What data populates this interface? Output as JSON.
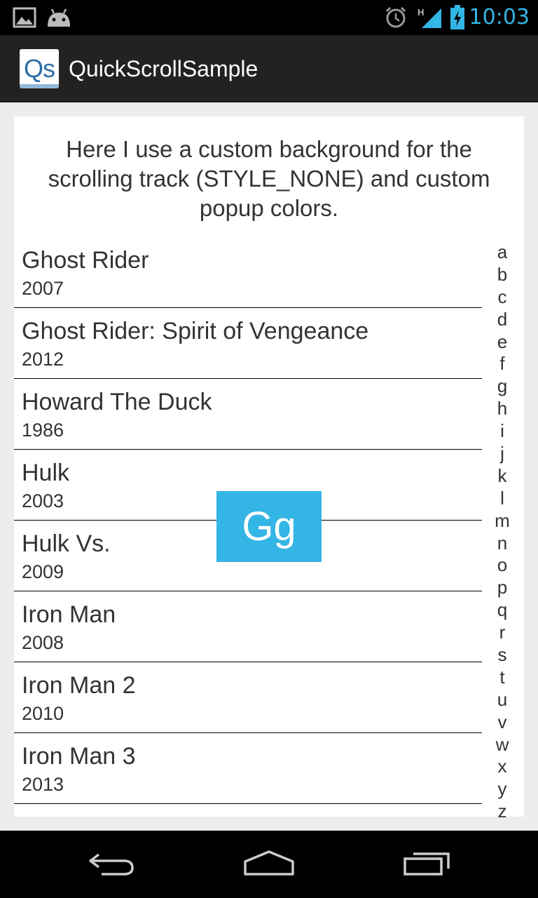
{
  "status_bar": {
    "time": "10:03",
    "network_type": "H",
    "icons": [
      "gallery-icon",
      "android-icon",
      "alarm-icon",
      "signal-icon",
      "battery-charging-icon"
    ]
  },
  "action_bar": {
    "logo_text": "Qs",
    "title": "QuickScrollSample"
  },
  "intro_text": "Here I use a custom background for the scrolling track (STYLE_NONE) and custom popup colors.",
  "movies": [
    {
      "title": "Ghost Rider",
      "year": "2007"
    },
    {
      "title": "Ghost Rider: Spirit of Vengeance",
      "year": "2012"
    },
    {
      "title": "Howard The Duck",
      "year": "1986"
    },
    {
      "title": "Hulk",
      "year": "2003"
    },
    {
      "title": "Hulk Vs.",
      "year": "2009"
    },
    {
      "title": "Iron Man",
      "year": "2008"
    },
    {
      "title": "Iron Man 2",
      "year": "2010"
    },
    {
      "title": "Iron Man 3",
      "year": "2013"
    }
  ],
  "index_letters": [
    "a",
    "b",
    "c",
    "d",
    "e",
    "f",
    "g",
    "h",
    "i",
    "j",
    "k",
    "l",
    "m",
    "n",
    "o",
    "p",
    "q",
    "r",
    "s",
    "t",
    "u",
    "v",
    "w",
    "x",
    "y",
    "z"
  ],
  "popup_text": "Gg",
  "colors": {
    "accent": "#33b5e5",
    "action_bar": "#222222",
    "background": "#ececec"
  },
  "nav_bar": {
    "buttons": [
      "back-icon",
      "home-icon",
      "recent-apps-icon"
    ]
  }
}
